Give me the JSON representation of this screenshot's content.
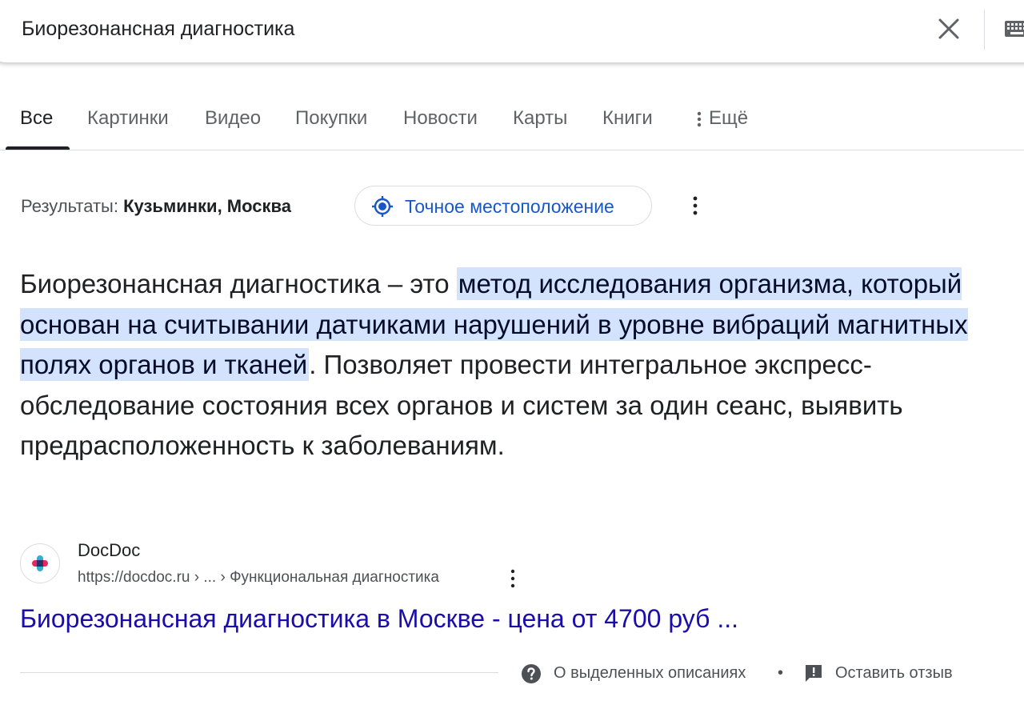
{
  "search": {
    "query": "Биорезонансная диагностика",
    "clear_icon": "close-icon",
    "keyboard_icon": "keyboard-icon"
  },
  "tabs": [
    {
      "label": "Все",
      "active": true
    },
    {
      "label": "Картинки"
    },
    {
      "label": "Видео"
    },
    {
      "label": "Покупки"
    },
    {
      "label": "Новости"
    },
    {
      "label": "Карты"
    },
    {
      "label": "Книги"
    },
    {
      "label": "Ещё",
      "icon": "more-vert-icon"
    }
  ],
  "location": {
    "prefix": "Результаты:",
    "place": "Кузьминки, Москва",
    "button_label": "Точное местоположение",
    "button_icon": "my-location-icon"
  },
  "snippet": {
    "before": "Биорезонансная диагностика – это ",
    "highlighted": "метод исследования организма, который основан на считывании датчиками нарушений в уровне вибраций магнитных полях органов и тканей",
    "after": ". Позволяет провести интегральное экспресс-обследование состояния всех органов и систем за один сеанс, выявить предрасположенность к заболеваниям.",
    "highlight_color": "#d3e3fd"
  },
  "source": {
    "site_name": "DocDoc",
    "url": "https://docdoc.ru › ... › Функциональная диагностика",
    "title": "Биорезонансная диагностика в Москве - цена от 4700 руб ..."
  },
  "footer": {
    "about_label": "О выделенных описаниях",
    "separator": "•",
    "feedback_label": "Оставить отзыв"
  },
  "colors": {
    "link": "#1a0dab",
    "accent": "#1a57c6",
    "text": "#202124",
    "muted": "#4d5156"
  }
}
